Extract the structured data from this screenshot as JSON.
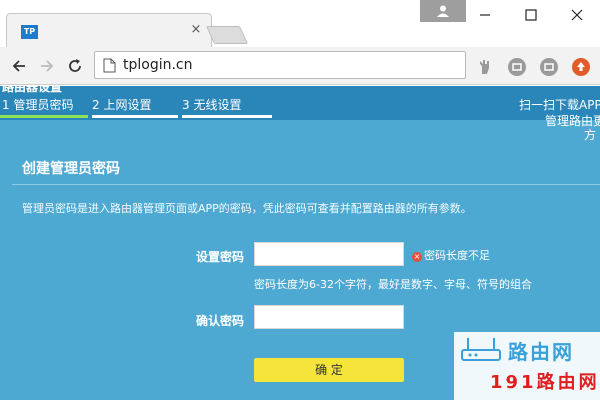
{
  "browser": {
    "tab": {
      "favicon": "TP",
      "title": "",
      "close": "×"
    },
    "address": "tplogin.cn",
    "icons": [
      "page-icon",
      "user-icon",
      "minimize-icon",
      "maximize-icon",
      "close-icon",
      "back-icon",
      "forward-icon",
      "reload-icon"
    ],
    "colors": {
      "favicon": "#1a7bd1",
      "ext_orange": "#e25c2a"
    }
  },
  "router_page": {
    "brand_peek": "路由器设置",
    "steps": [
      {
        "label": "1 管理员密码",
        "active": true
      },
      {
        "label": "2 上网设置",
        "active": false
      },
      {
        "label": "3 无线设置",
        "active": false
      }
    ],
    "app_download": {
      "line1": "扫一扫下载APP",
      "line2": "管理路由更",
      "line3": "方"
    },
    "section_title": "创建管理员密码",
    "description": "管理员密码是进入路由器管理页面或APP的密码，凭此密码可查看并配置路由器的所有参数。",
    "fields": {
      "set_password": {
        "label": "设置密码",
        "value": ""
      },
      "confirm_password": {
        "label": "确认密码",
        "value": ""
      }
    },
    "error": "密码长度不足",
    "hint": "密码长度为6-32个字符，最好是数字、字母、符号的组合",
    "confirm_button": "确 定",
    "colors": {
      "bg": "#4ea9d2",
      "steps_bar": "#2a86b8",
      "active_step": "#8fe35a",
      "button": "#f5e43a",
      "error": "#e0533b"
    }
  },
  "watermark": {
    "top": "路由网",
    "bottom": "191路由网"
  }
}
